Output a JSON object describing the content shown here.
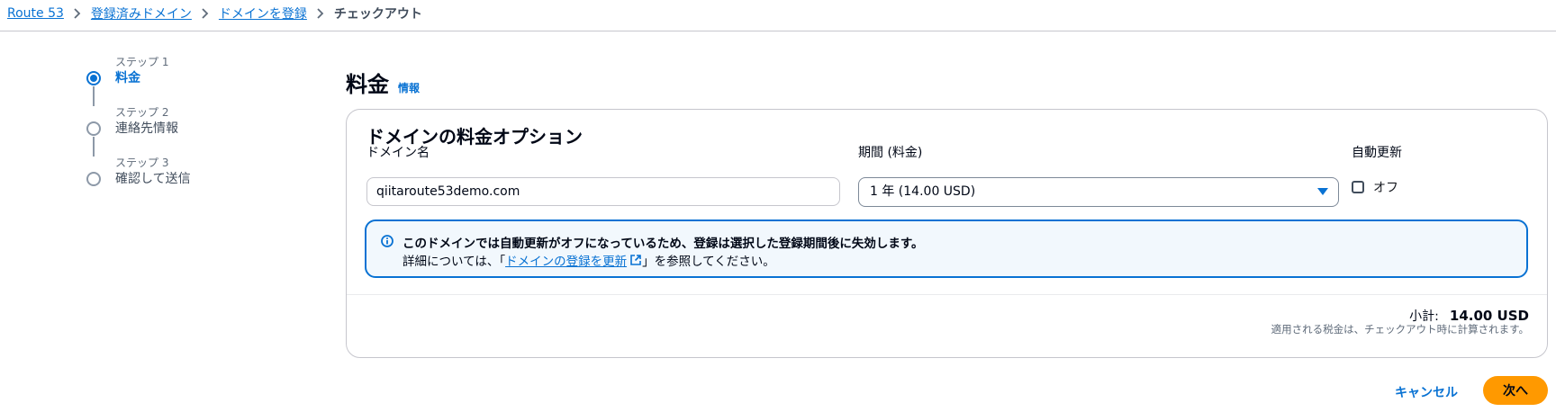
{
  "breadcrumb": {
    "items": [
      "Route 53",
      "登録済みドメイン",
      "ドメインを登録"
    ],
    "current": "チェックアウト"
  },
  "steps": [
    {
      "small": "ステップ 1",
      "title": "料金",
      "active": true
    },
    {
      "small": "ステップ 2",
      "title": "連絡先情報",
      "active": false
    },
    {
      "small": "ステップ 3",
      "title": "確認して送信",
      "active": false
    }
  ],
  "page": {
    "title": "料金",
    "info_link": "情報"
  },
  "card": {
    "title": "ドメインの料金オプション",
    "domain_label": "ドメイン名",
    "domain_value": "qiitaroute53demo.com",
    "period_label": "期間 (料金)",
    "period_value": "1 年 (14.00 USD)",
    "auto_renew_label": "自動更新",
    "auto_renew_option": "オフ",
    "auto_renew_checked": false
  },
  "alert": {
    "line1": "このドメインでは自動更新がオフになっているため、登録は選択した登録期間後に失効します。",
    "line2_prefix": "詳細については、「",
    "link": "ドメインの登録を更新",
    "line2_suffix": "」を参照してください。"
  },
  "summary": {
    "subtotal_label": "小計:",
    "subtotal_value": "14.00 USD",
    "tax_note": "適用される税金は、チェックアウト時に計算されます。"
  },
  "actions": {
    "cancel": "キャンセル",
    "next": "次へ"
  },
  "colors": {
    "accent": "#0972d3",
    "primary_button": "#ff9900",
    "alert_bg": "#f2f8fd"
  },
  "icons": {
    "breadcrumb_separator": "chevron-right-icon",
    "alert": "info-icon",
    "external_link": "external-link-icon",
    "select_caret": "caret-down-icon"
  }
}
